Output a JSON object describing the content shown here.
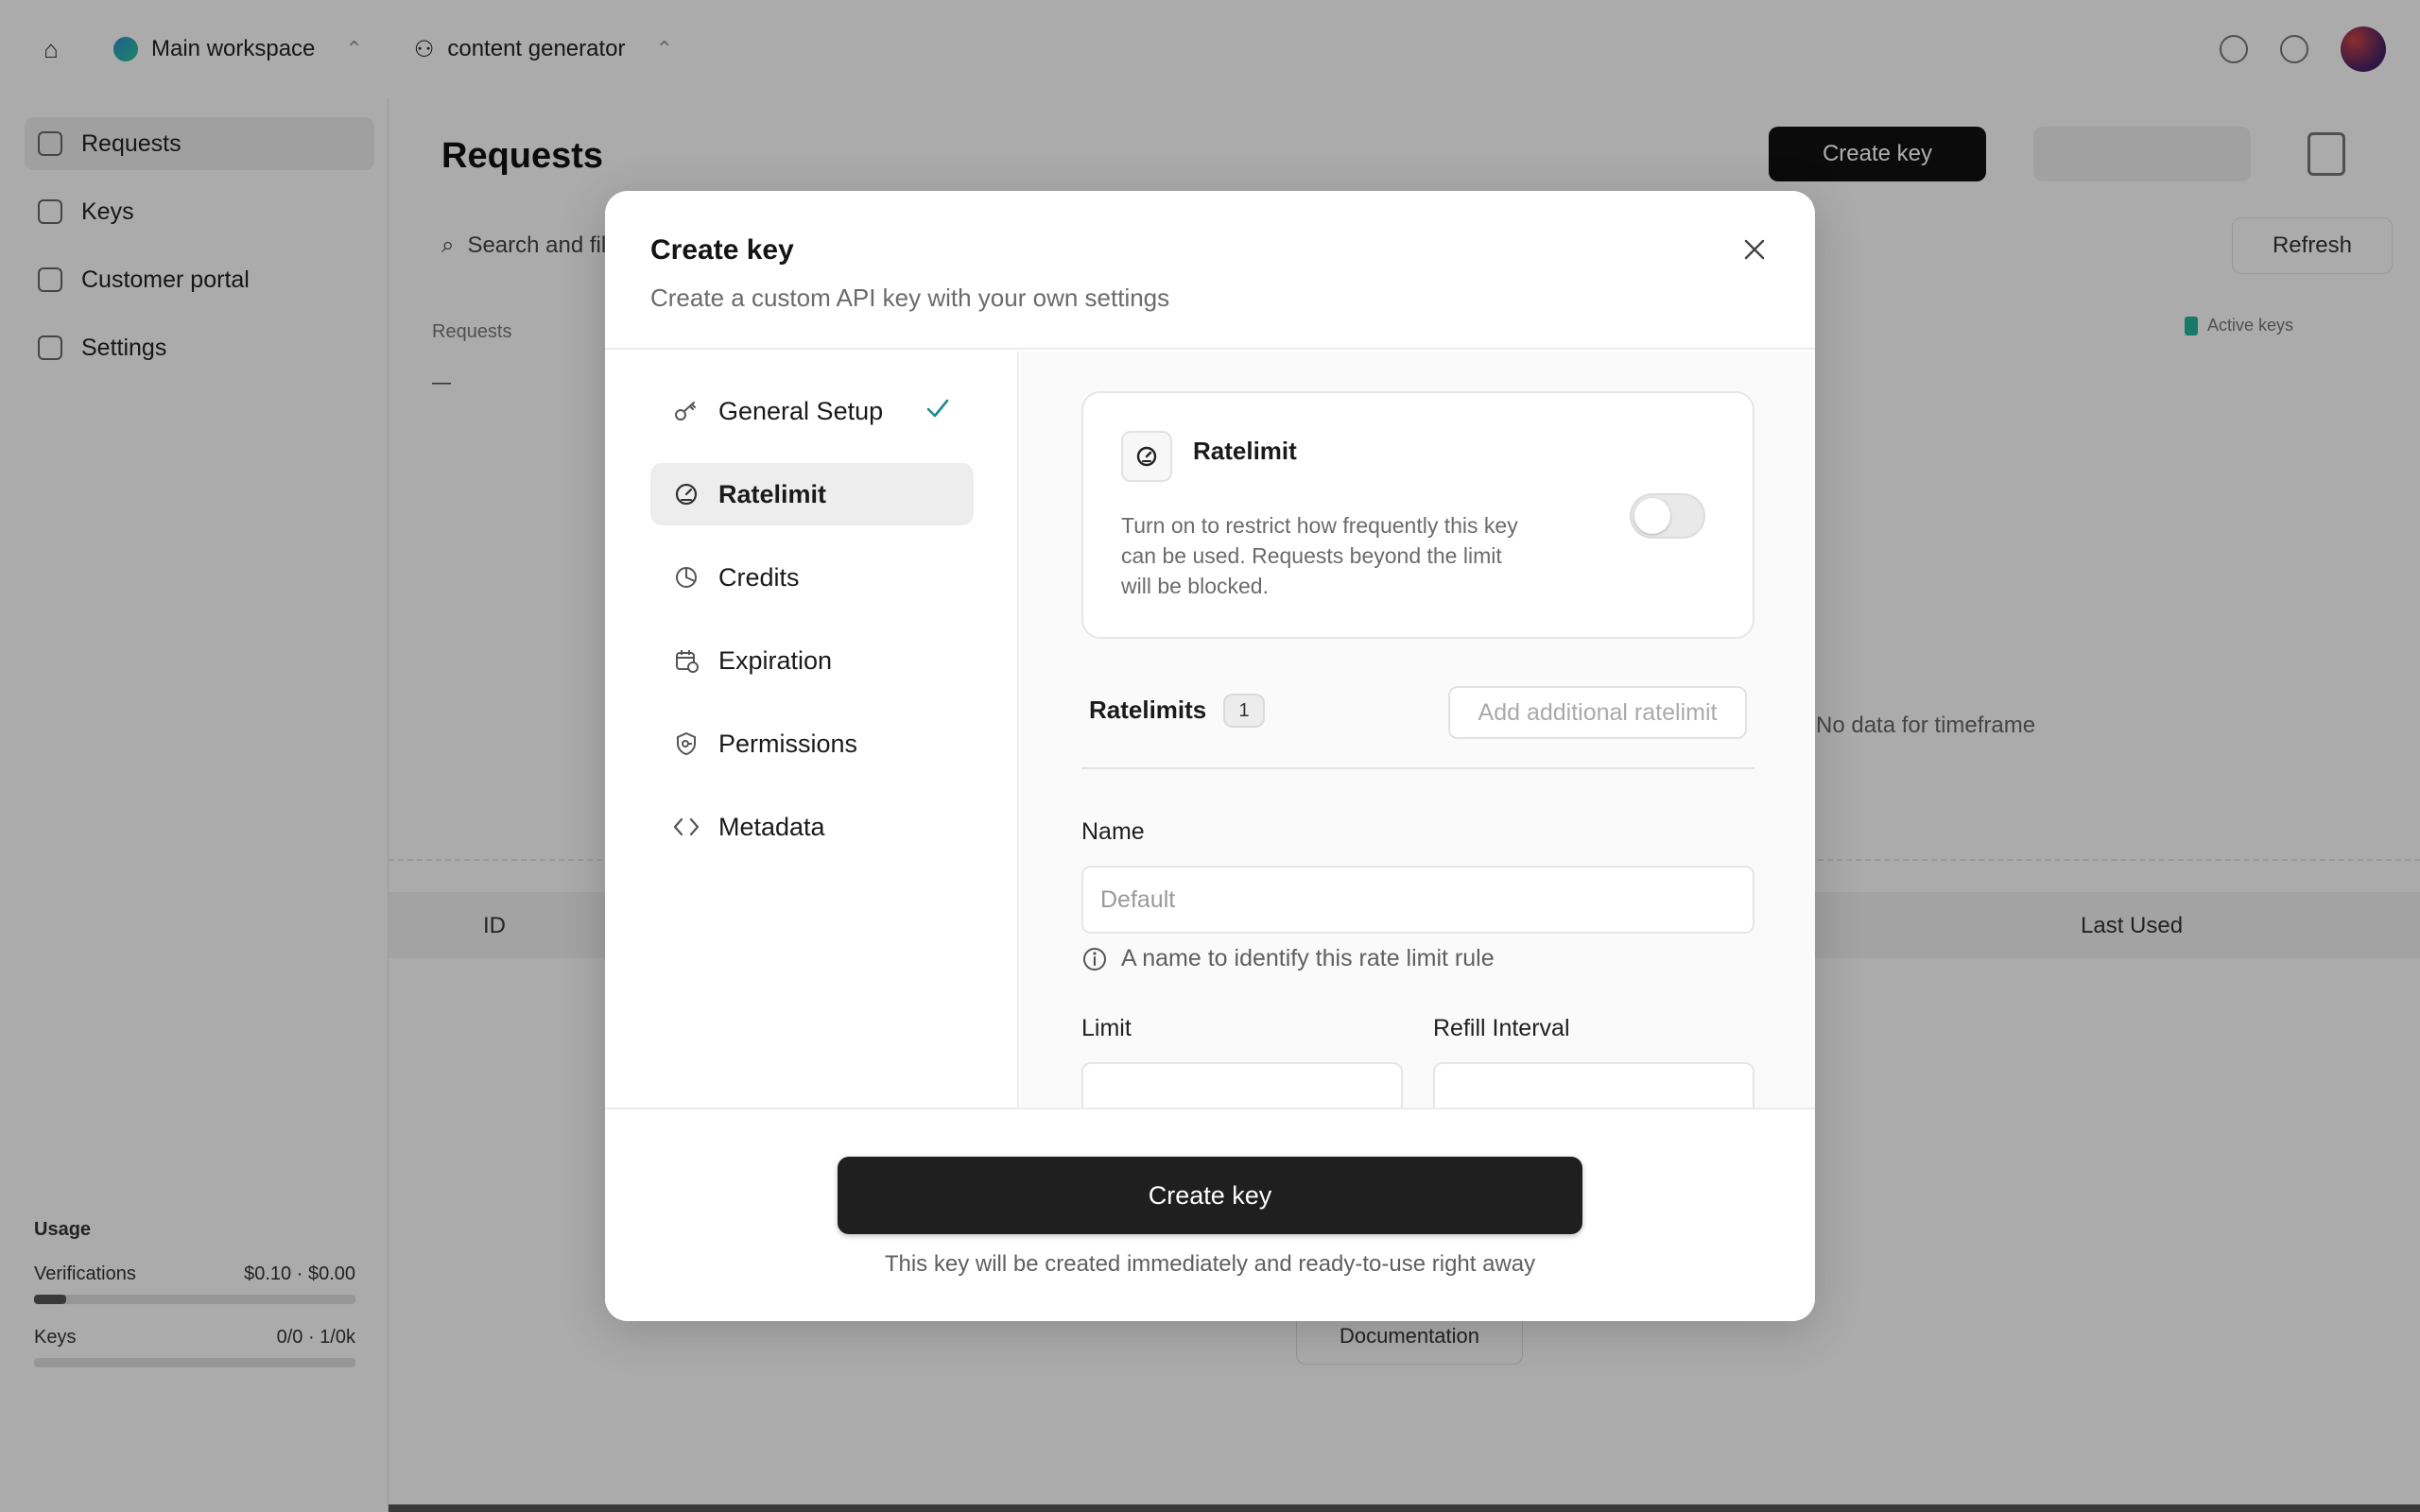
{
  "background": {
    "workspace": "Main workspace",
    "project": "content generator",
    "sidebar": [
      "Requests",
      "Keys",
      "Customer portal",
      "Settings"
    ],
    "page_title": "Requests",
    "create_button": "Create key",
    "search_placeholder": "Search and filter",
    "refresh": "Refresh",
    "stat_label": "Requests",
    "stat_value": "—",
    "legend": "Active keys",
    "legend_value": "—",
    "nodata": "No data for timeframe",
    "col_id": "ID",
    "col_last_used": "Last Used",
    "documentation": "Documentation",
    "usage": {
      "title": "Usage",
      "row1_label": "Verifications",
      "row1_value": "$0.10 · $0.00",
      "row1_progress": 0.1,
      "row2_label": "Keys",
      "row2_value": "0/0 · 1/0k",
      "row2_progress": 0.0
    }
  },
  "modal": {
    "title": "Create key",
    "subtitle": "Create a custom API key with your own settings",
    "nav": [
      {
        "label": "General Setup",
        "icon": "key-icon",
        "completed": true
      },
      {
        "label": "Ratelimit",
        "icon": "gauge-icon",
        "active": true
      },
      {
        "label": "Credits",
        "icon": "pie-chart-icon"
      },
      {
        "label": "Expiration",
        "icon": "calendar-clock-icon"
      },
      {
        "label": "Permissions",
        "icon": "shield-key-icon"
      },
      {
        "label": "Metadata",
        "icon": "code-icon"
      }
    ],
    "ratelimit_card": {
      "title": "Ratelimit",
      "description": "Turn on to restrict how frequently this key can be used. Requests beyond the limit will be blocked.",
      "enabled": false
    },
    "ratelimits": {
      "label": "Ratelimits",
      "count": "1",
      "add_button": "Add additional ratelimit"
    },
    "name_field": {
      "label": "Name",
      "placeholder": "Default",
      "value": "",
      "hint": "A name to identify this rate limit rule"
    },
    "limit_label": "Limit",
    "refill_label": "Refill Interval",
    "create_button": "Create key",
    "footer_note": "This key will be created immediately and ready-to-use right away"
  },
  "colors": {
    "accent_check": "#1f8a8a",
    "primary_button": "#1f1f1f",
    "overlay": "rgba(0,0,0,0.32)"
  }
}
